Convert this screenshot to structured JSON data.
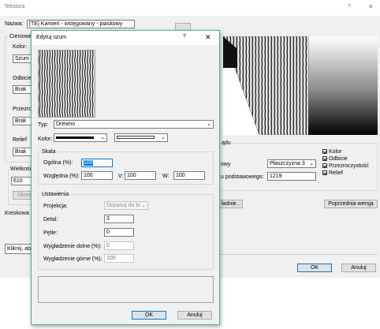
{
  "main": {
    "title": "Tekstura",
    "help_label": "?",
    "close_label": "✕",
    "name_label": "Nazwa:",
    "name_value": "[TE] Kamień - wstęgowany - piaskowy",
    "left_labels": [
      "Cieniowe",
      "Kolor:",
      "Szum",
      "Odbicie",
      "Brak",
      "Przezro",
      "Brak",
      "Relief",
      "Brak",
      "Wielkość",
      "610",
      "Okres",
      "Kreskowa",
      "Kliknij, ab"
    ],
    "section_label": "ądu",
    "projection_label": "owy",
    "projection_value": "Płaszczyzna 3",
    "base_label": "u podstawowego:",
    "base_value": "1219",
    "checkboxes": [
      "Kolor",
      "Odbicie",
      "Przezroczystość",
      "Relief"
    ],
    "edit_button_fragment": "ładnie...",
    "prev_version_button": "Poprzednia wersja",
    "ok": "OK",
    "cancel": "Anuluj"
  },
  "dialog": {
    "title": "Edytuj szum",
    "help_label": "?",
    "close_label": "✕",
    "type_label": "Typ:",
    "type_value": "Drewno",
    "color_label": "Kolor:",
    "colors": {
      "primary": "#000000",
      "secondary": "#ffffff",
      "accent": "#0078d7",
      "border": "#5aa9a0"
    },
    "scale": {
      "group_label": "Skala",
      "overall_label": "Ogólna (%):",
      "overall_value": "100",
      "relative_label": "Względna (%):",
      "relative_value": "100",
      "v_label": "V:",
      "v_value": "100",
      "w_label": "W:",
      "w_value": "100"
    },
    "settings": {
      "group_label": "Ustawienia",
      "projection_label": "Projekcja:",
      "projection_value": "Dopasuj do bi",
      "detail_label": "Detal:",
      "detail_value": "3",
      "loops_label": "Pętle:",
      "loops_value": "0",
      "smooth_low_label": "Wygładzenie dolne (%):",
      "smooth_low_value": "0",
      "smooth_high_label": "Wygładzenie górne (%):",
      "smooth_high_value": "100"
    },
    "ok": "OK",
    "cancel": "Anuluj"
  }
}
